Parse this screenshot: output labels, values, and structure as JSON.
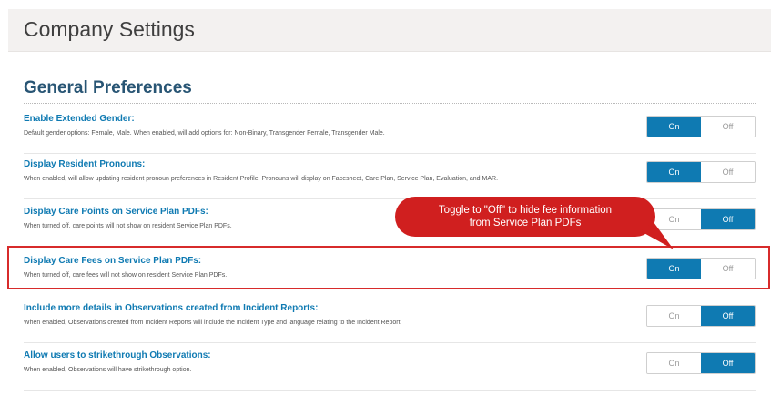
{
  "header": {
    "title": "Company Settings"
  },
  "section": {
    "title": "General Preferences"
  },
  "toggle_labels": {
    "on": "On",
    "off": "Off"
  },
  "settings": [
    {
      "title": "Enable Extended Gender:",
      "description": "Default gender options: Female, Male. When enabled, will add options for: Non-Binary, Transgender Female, Transgender Male.",
      "state": "On"
    },
    {
      "title": "Display Resident Pronouns:",
      "description": "When enabled, will allow updating resident pronoun preferences in Resident Profile. Pronouns will display on Facesheet, Care Plan, Service Plan, Evaluation, and MAR.",
      "state": "On"
    },
    {
      "title": "Display Care Points on Service Plan PDFs:",
      "description": "When turned off, care points will not show on resident Service Plan PDFs.",
      "state": "Off"
    },
    {
      "title": "Display Care Fees on Service Plan PDFs:",
      "description": "When turned off, care fees will not show on resident Service Plan PDFs.",
      "state": "On"
    },
    {
      "title": "Include more details in Observations created from Incident Reports:",
      "description": "When enabled, Observations created from Incident Reports will include the Incident Type and language relating to the Incident Report.",
      "state": "Off"
    },
    {
      "title": "Allow users to strikethrough Observations:",
      "description": "When enabled, Observations will have strikethrough option.",
      "state": "Off"
    }
  ],
  "callout": {
    "line1": "Toggle to \"Off\" to hide fee information",
    "line2": "from Service Plan PDFs",
    "color": "#d01f1f"
  },
  "colors": {
    "accent": "#0f7ab2",
    "highlight": "#d72b2b",
    "heading": "#285574"
  }
}
